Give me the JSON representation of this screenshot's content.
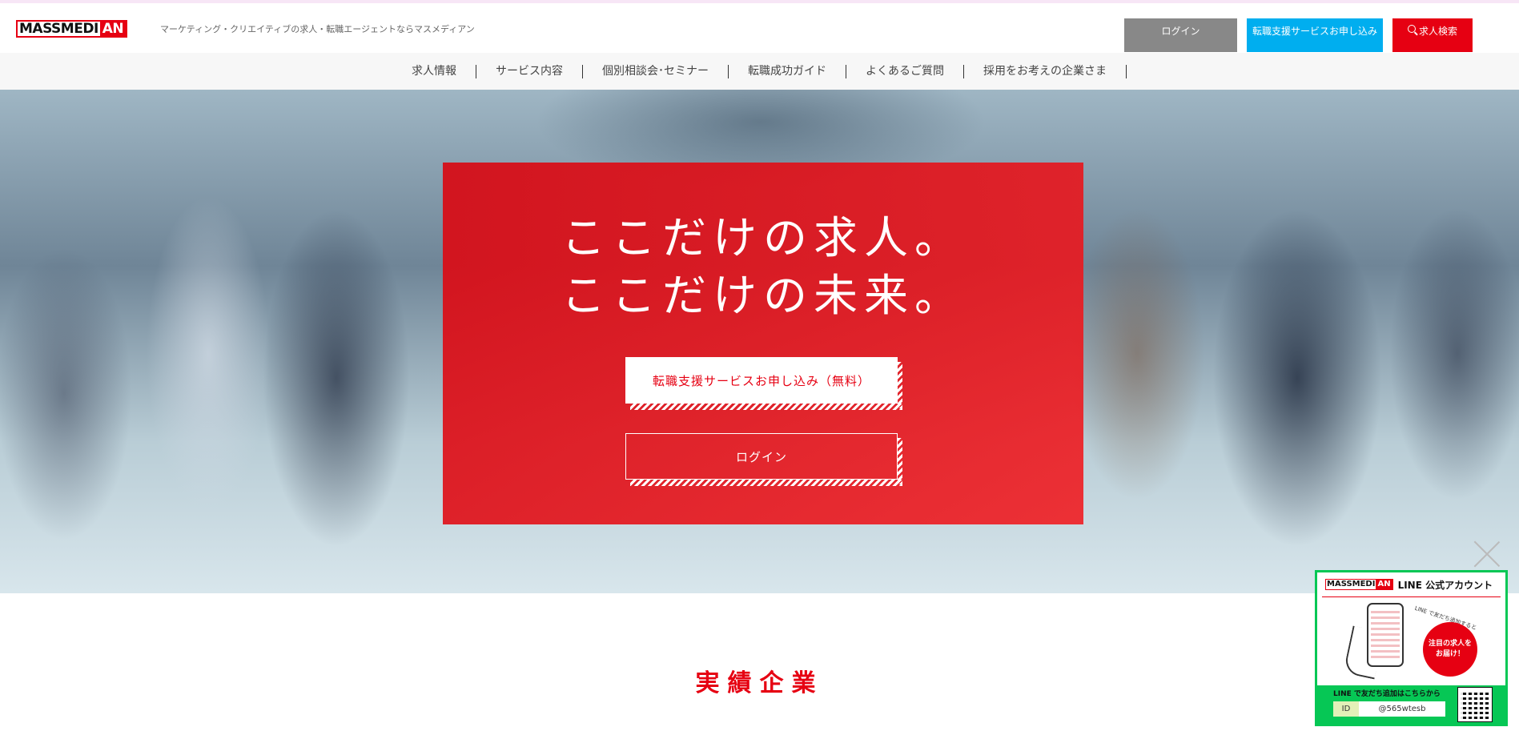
{
  "header": {
    "logo": {
      "part_a": "MASSMEDI",
      "part_b": "AN"
    },
    "tagline": "マーケティング・クリエイティブの求人・転職エージェントならマスメディアン",
    "login_label": "ログイン",
    "apply_label": "転職支援サービスお申し込み",
    "search_label": "求人検索",
    "colors": {
      "login": "#888888",
      "apply": "#00aeef",
      "search": "#e60012"
    }
  },
  "nav": {
    "items": [
      {
        "label": "求人情報"
      },
      {
        "label": "サービス内容"
      },
      {
        "label": "個別相談会･セミナー"
      },
      {
        "label": "転職成功ガイド"
      },
      {
        "label": "よくあるご質問"
      },
      {
        "label": "採用をお考えの企業さま"
      }
    ]
  },
  "hero": {
    "title_line1": "ここだけの求人。",
    "title_line2": "ここだけの未来。",
    "primary_cta": "転職支援サービスお申し込み（無料）",
    "secondary_cta": "ログイン",
    "accent": "#e60012"
  },
  "section": {
    "title": "実績企業"
  },
  "line_promo": {
    "logo": {
      "part_a": "MASSMEDI",
      "part_b": "AN"
    },
    "title": "LINE 公式アカウント",
    "note": "LINE で友だち追加すると",
    "bubble_text": "注目の求人をお届け！",
    "footer_text": "LINE で友だち追加はこちらから",
    "id_label": "ID",
    "id_value": "@565wtesb",
    "color": "#06c755"
  }
}
